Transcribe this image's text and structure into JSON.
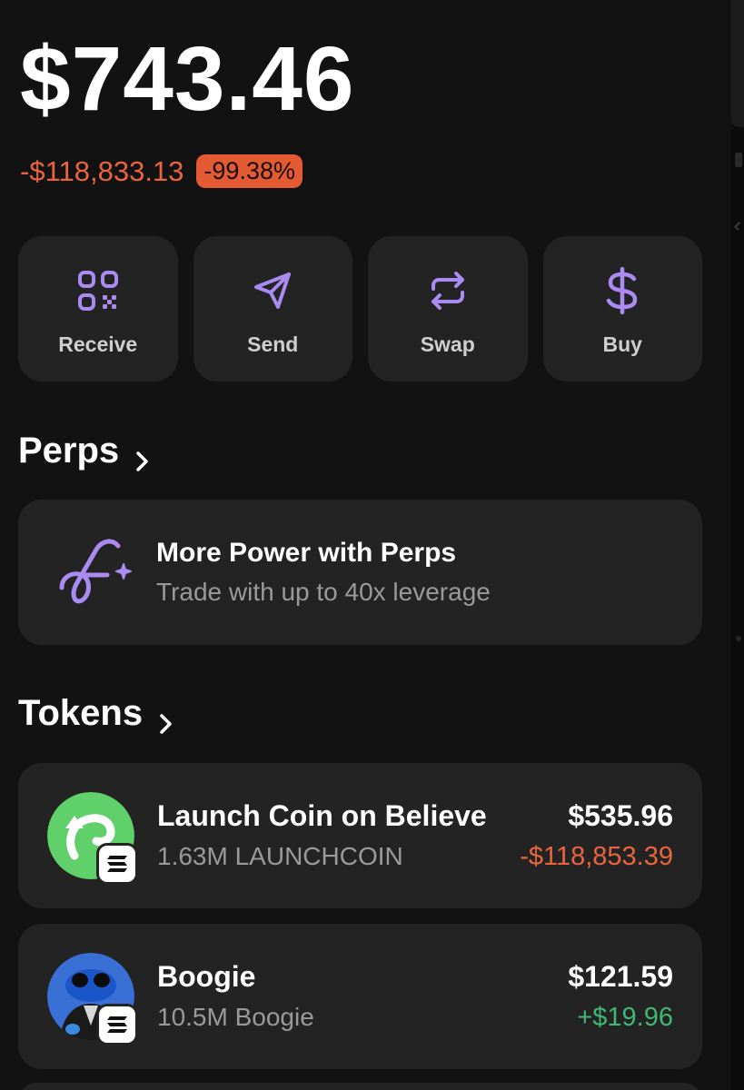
{
  "portfolio": {
    "balance": "$743.46",
    "change_abs": "-$118,833.13",
    "change_pct": "-99.38%"
  },
  "actions": [
    {
      "label": "Receive",
      "icon": "qr-code-icon"
    },
    {
      "label": "Send",
      "icon": "send-icon"
    },
    {
      "label": "Swap",
      "icon": "swap-icon"
    },
    {
      "label": "Buy",
      "icon": "dollar-icon"
    }
  ],
  "perps": {
    "section_title": "Perps",
    "card_title": "More Power with Perps",
    "card_subtitle": "Trade with up to 40x leverage"
  },
  "tokens": {
    "section_title": "Tokens",
    "items": [
      {
        "name": "Launch Coin on Believe",
        "amount": "1.63M LAUNCHCOIN",
        "value": "$535.96",
        "pnl": "-$118,853.39",
        "pnl_direction": "negative"
      },
      {
        "name": "Boogie",
        "amount": "10.5M Boogie",
        "value": "$121.59",
        "pnl": "+$19.96",
        "pnl_direction": "positive"
      }
    ]
  },
  "colors": {
    "background": "#121212",
    "card": "#232323",
    "accent_purple": "#a98bf2",
    "negative": "#e9653f",
    "positive": "#3fb873"
  }
}
